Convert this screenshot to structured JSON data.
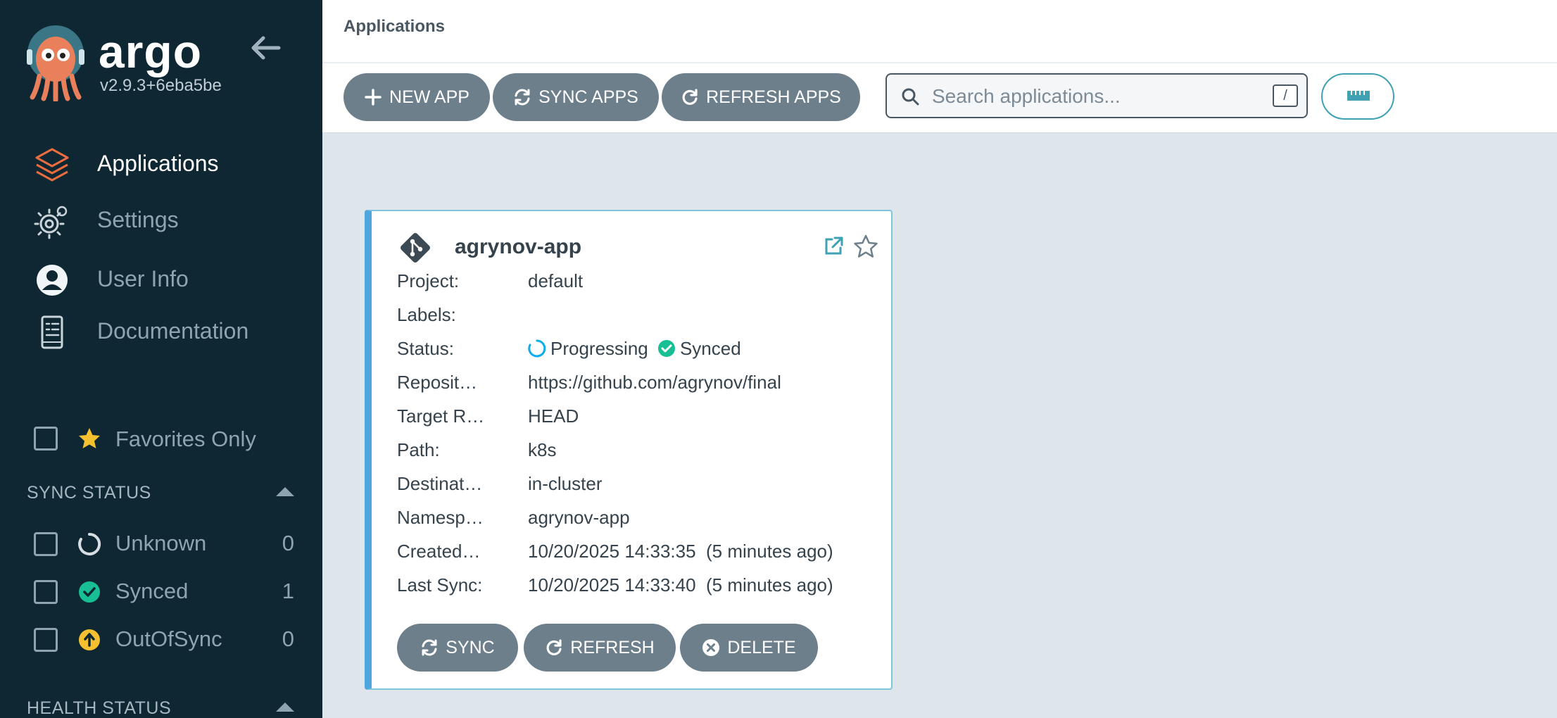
{
  "sidebar": {
    "brand": "argo",
    "version": "v2.9.3+6eba5be",
    "nav": [
      {
        "label": "Applications",
        "icon": "layers-icon",
        "active": true
      },
      {
        "label": "Settings",
        "icon": "gear-icon",
        "active": false
      },
      {
        "label": "User Info",
        "icon": "user-icon",
        "active": false
      },
      {
        "label": "Documentation",
        "icon": "book-icon",
        "active": false
      }
    ],
    "favorites_label": "Favorites Only",
    "sync_status": {
      "title": "SYNC STATUS",
      "items": [
        {
          "label": "Unknown",
          "count": "0",
          "icon": "circle-notch-icon"
        },
        {
          "label": "Synced",
          "count": "1",
          "icon": "check-circle-icon"
        },
        {
          "label": "OutOfSync",
          "count": "0",
          "icon": "arrow-up-circle-icon"
        }
      ]
    },
    "health_status": {
      "title": "HEALTH STATUS"
    }
  },
  "header": {
    "title": "Applications"
  },
  "toolbar": {
    "new_app": "NEW APP",
    "sync_apps": "SYNC APPS",
    "refresh_apps": "REFRESH APPS",
    "search_placeholder": "Search applications...",
    "search_value": "",
    "search_shortcut": "/"
  },
  "app": {
    "name": "agrynov-app",
    "fields": [
      {
        "key": "Project:",
        "value": "default"
      },
      {
        "key": "Labels:",
        "value": ""
      },
      {
        "key": "Status:",
        "health": "Progressing",
        "sync": "Synced"
      },
      {
        "key": "Repository:",
        "value": "https://github.com/agrynov/final"
      },
      {
        "key": "Target Revision:",
        "value": "HEAD"
      },
      {
        "key": "Path:",
        "value": "k8s"
      },
      {
        "key": "Destination:",
        "value": "in-cluster"
      },
      {
        "key": "Namespace:",
        "value": "agrynov-app"
      },
      {
        "key": "Created At:",
        "value": "10/20/2025 14:33:35  (5 minutes ago)"
      },
      {
        "key": "Last Sync:",
        "value": "10/20/2025 14:33:40  (5 minutes ago)"
      }
    ],
    "buttons": {
      "sync": "SYNC",
      "refresh": "REFRESH",
      "delete": "DELETE"
    }
  },
  "colors": {
    "sidebar_bg": "#0f2733",
    "button_bg": "#6d7f8b",
    "accent_teal": "#3fa1b3",
    "card_left_border": "#4fa6dd",
    "synced_green": "#18be94",
    "out_of_sync_yellow": "#f4c030",
    "progressing_blue": "#0dadea",
    "argo_orange": "#e96d3e"
  }
}
